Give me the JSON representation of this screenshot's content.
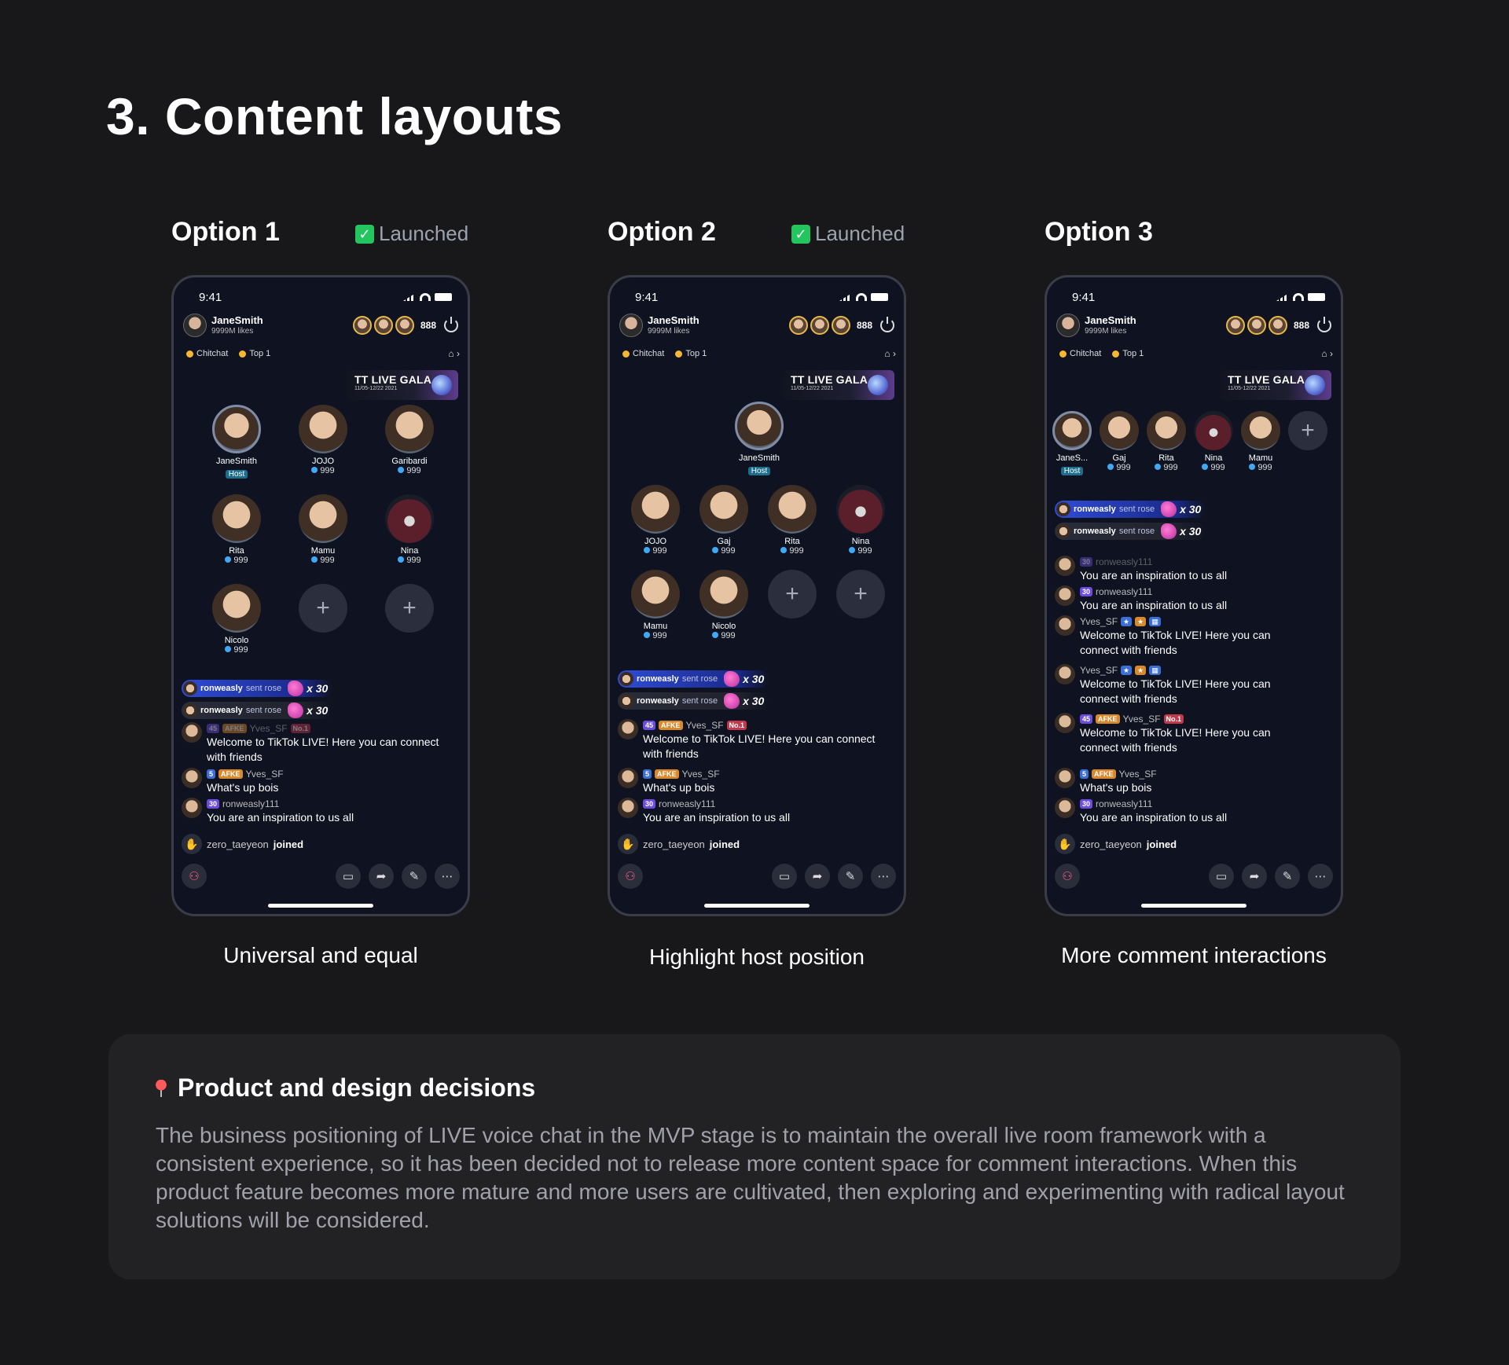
{
  "page_title": "3. Content layouts",
  "statusbar_time": "9:41",
  "host": {
    "name": "JaneSmith",
    "likes": "9999M likes",
    "viewer_count": "888"
  },
  "tags": {
    "chitchat": "Chitchat",
    "top": "Top 1"
  },
  "gala": {
    "title": "TT LIVE GALA",
    "date": "11/05-12/22 2021"
  },
  "gift": {
    "sender": "ronweasly",
    "action": "sent rose",
    "count": "x 30"
  },
  "host_badge": "Host",
  "score": "999",
  "comments": {
    "welcome": "Welcome to TikTok LIVE! Here you can connect with friends",
    "welcome_l1": "Welcome to TikTok LIVE! Here you can",
    "welcome_l2": "connect with friends",
    "whats_up": "What's up bois",
    "inspiration": "You are an inspiration to us all",
    "user_yves": "Yves_SF",
    "user_ron": "ronweasly111",
    "badge_45": "45",
    "badge_5": "5",
    "badge_30": "30",
    "badge_afke": "AFKE",
    "badge_no1": "No.1"
  },
  "joined": {
    "name": "zero_taeyeon",
    "word": "joined"
  },
  "options": [
    {
      "title": "Option 1",
      "status": "Launched",
      "caption": "Universal and equal",
      "seats": [
        "JaneSmith",
        "JOJO",
        "Garibardi",
        "Rita",
        "Mamu",
        "Nina",
        "Nicolo"
      ]
    },
    {
      "title": "Option 2",
      "status": "Launched",
      "caption": "Highlight host position",
      "seats": [
        "JaneSmith",
        "JOJO",
        "Gaj",
        "Rita",
        "Nina",
        "Mamu",
        "Nicolo"
      ]
    },
    {
      "title": "Option 3",
      "status": "",
      "caption": "More comment interactions",
      "seats": [
        "JaneS...",
        "Gaj",
        "Rita",
        "Nina",
        "Mamu"
      ]
    }
  ],
  "decisions": {
    "title": "Product and design decisions",
    "text": "The business positioning of LIVE voice chat in the MVP stage is to maintain the overall live room framework with a consistent experience, so it has been decided not to release more content space for comment interactions. When this product feature becomes more mature and more users are cultivated, then exploring and experimenting with radical layout solutions will be considered."
  },
  "colors": {
    "background": "#18181b",
    "phone_bg": "#0f1321",
    "gift_highlight": "#2f4bd8",
    "launched_check": "#22c55e",
    "score_dot": "#3fa9f5"
  }
}
